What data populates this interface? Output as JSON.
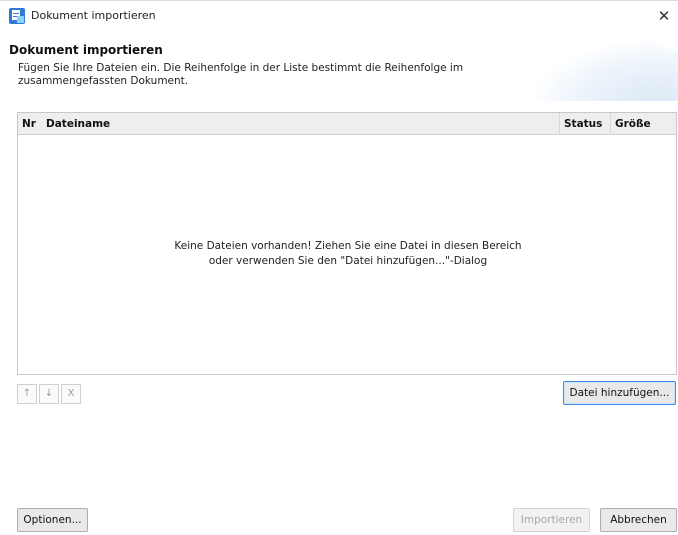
{
  "window": {
    "title": "Dokument importieren",
    "close_glyph": "✕"
  },
  "header": {
    "title": "Dokument importieren",
    "description": "Fügen Sie Ihre Dateien ein. Die Reihenfolge in der Liste bestimmt die Reihenfolge im zusammengefassten Dokument."
  },
  "table": {
    "columns": [
      "Nr",
      "Dateiname",
      "Status",
      "Größe"
    ],
    "rows": [],
    "empty_message_line1": "Keine Dateien vorhanden! Ziehen Sie eine Datei in diesen Bereich",
    "empty_message_line2": "oder verwenden Sie den \"Datei hinzufügen...\"-Dialog"
  },
  "list_tools": {
    "up": "↑",
    "down": "↓",
    "remove": "X"
  },
  "buttons": {
    "add_file": "Datei hinzufügen...",
    "options": "Optionen...",
    "import": "Importieren",
    "cancel": "Abbrechen"
  },
  "colors": {
    "header_accent": "#dbe8f7",
    "focus_border": "#3d8ee0",
    "disabled_text": "#a8a8a8"
  },
  "icons": {
    "app": "document-import-icon",
    "close": "close-icon"
  }
}
